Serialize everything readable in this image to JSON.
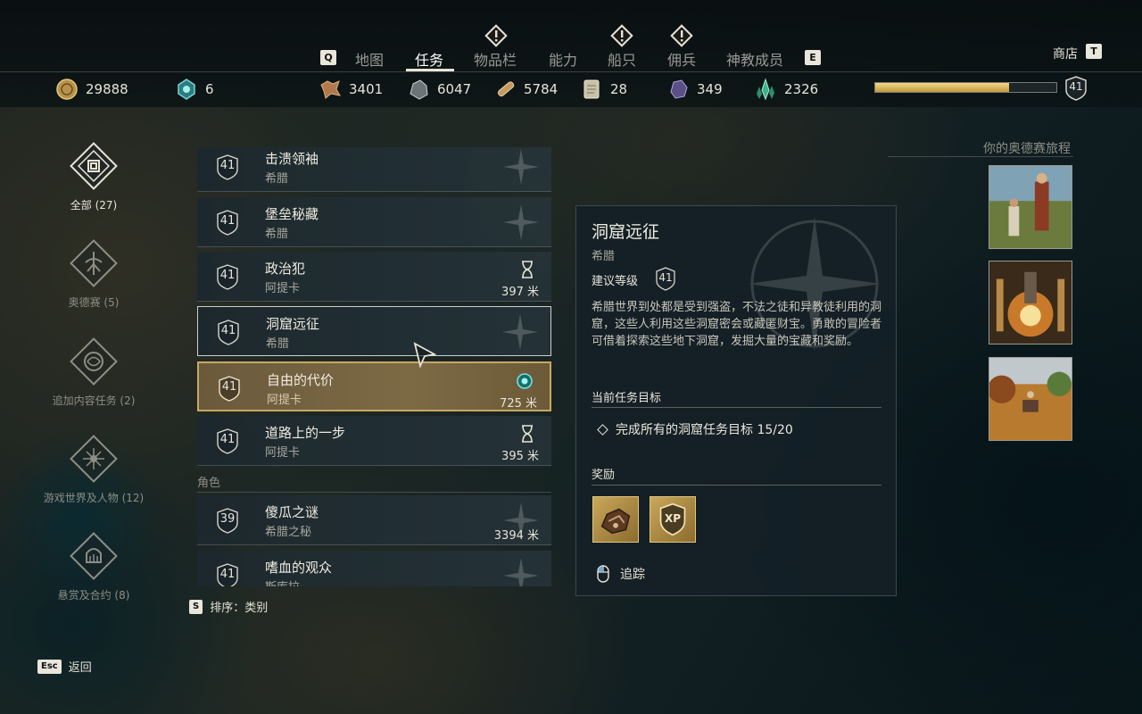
{
  "tabs": {
    "left_key": "Q",
    "right_key": "E",
    "items": [
      "地图",
      "任务",
      "物品栏",
      "能力",
      "船只",
      "佣兵",
      "神教成员"
    ],
    "active": "任务"
  },
  "shop": {
    "label": "商店",
    "key": "T"
  },
  "resources": {
    "drachmae": "29888",
    "orichalcum": "6",
    "leather": "3401",
    "iron": "6047",
    "wood": "5784",
    "stone": "28",
    "obsidian": "349",
    "crystal": "2326"
  },
  "player": {
    "level": "41",
    "xp_progress": 0.74
  },
  "categories": [
    {
      "label": "全部 (27)",
      "icon": "all-quests-icon",
      "active": true
    },
    {
      "label": "奥德赛 (5)",
      "icon": "odyssey-icon",
      "active": false
    },
    {
      "label": "追加内容任务 (2)",
      "icon": "dlc-quests-icon",
      "active": false
    },
    {
      "label": "游戏世界及人物 (12)",
      "icon": "world-characters-icon",
      "active": false
    },
    {
      "label": "悬赏及合约 (8)",
      "icon": "bounties-contracts-icon",
      "active": false
    }
  ],
  "quests": [
    {
      "level": "41",
      "title": "击溃领袖",
      "region": "希腊",
      "distance": "",
      "status": ""
    },
    {
      "level": "41",
      "title": "堡垒秘藏",
      "region": "希腊",
      "distance": "",
      "status": ""
    },
    {
      "level": "41",
      "title": "政治犯",
      "region": "阿提卡",
      "distance": "397 米",
      "status": "hourglass"
    },
    {
      "level": "41",
      "title": "洞窟远征",
      "region": "希腊",
      "distance": "",
      "status": "",
      "hover": true
    },
    {
      "level": "41",
      "title": "自由的代价",
      "region": "阿提卡",
      "distance": "725 米",
      "status": "tracked",
      "selected": true
    },
    {
      "level": "41",
      "title": "道路上的一步",
      "region": "阿提卡",
      "distance": "395 米",
      "status": "hourglass"
    },
    {
      "level": "39",
      "title": "傻瓜之谜",
      "region": "希腊之秘",
      "distance": "3394 米",
      "status": ""
    },
    {
      "level": "41",
      "title": "嗜血的观众",
      "region": "斯库拉",
      "distance": "",
      "status": ""
    }
  ],
  "section_label": "角色",
  "detail": {
    "title": "洞窟远征",
    "region": "希腊",
    "recommended_label": "建议等级",
    "recommended_level": "41",
    "description": "希腊世界到处都是受到强盗，不法之徒和异教徒利用的洞窟，这些人利用这些洞窟密会或藏匿财宝。勇敢的冒险者可借着探索这些地下洞窟，发掘大量的宝藏和奖励。",
    "objective_header": "当前任务目标",
    "objective": "完成所有的洞窟任务目标 15/20",
    "reward_header": "奖励",
    "reward_xp": "XP",
    "track_label": "追踪"
  },
  "journey": {
    "label": "你的奥德赛旅程"
  },
  "hints": {
    "sort_key": "S",
    "sort_label": "排序：类别",
    "back_key": "Esc",
    "back_label": "返回"
  },
  "colors": {
    "gold": "#c8a864",
    "accent_teal": "#3fb6b2",
    "panel": "#142026"
  }
}
